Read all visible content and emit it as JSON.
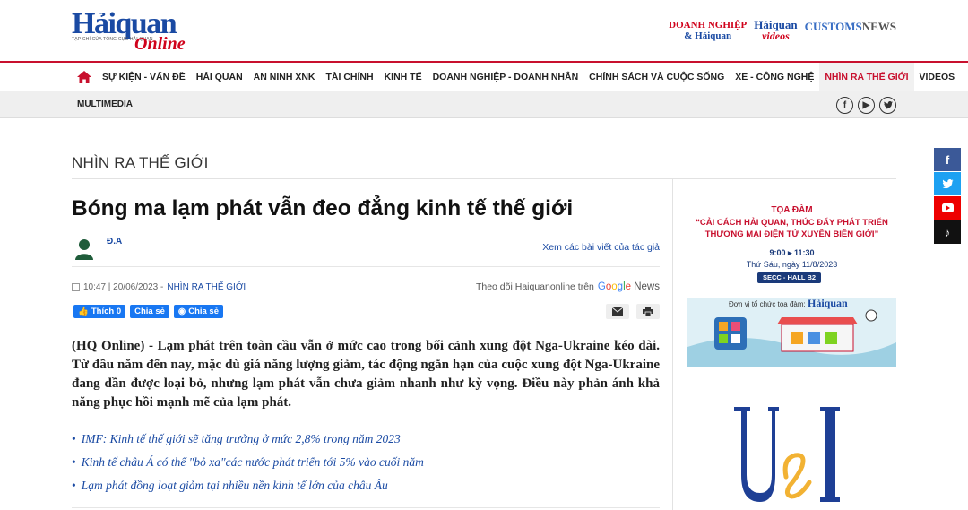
{
  "header": {
    "logo_main": "Hảiquan",
    "logo_online": "Online",
    "logo_sub": "TẠP CHÍ CỦA TỔNG CỤC HẢI QUAN",
    "partner_dn_line1": "DOANH NGHIỆP",
    "partner_dn_line2": "& Hảiquan",
    "partner_video_line1": "Hảiquan",
    "partner_video_line2": "videos",
    "partner_customs_a": "CUSTOMS",
    "partner_customs_b": "NEWS"
  },
  "nav": {
    "items": [
      "SỰ KIỆN - VẤN ĐỀ",
      "HẢI QUAN",
      "AN NINH XNK",
      "TÀI CHÍNH",
      "KINH TẾ",
      "DOANH NGHIỆP - DOANH NHÂN",
      "CHÍNH SÁCH VÀ CUỘC SỐNG",
      "XE - CÔNG NGHỆ",
      "NHÌN RA THẾ GIỚI",
      "VIDEOS"
    ],
    "active_index": 8,
    "sub_item": "MULTIMEDIA"
  },
  "article": {
    "section": "NHÌN RA THẾ GIỚI",
    "title": "Bóng ma lạm phát vẫn đeo đẳng kinh tế thế giới",
    "author": "Đ.A",
    "author_more": "Xem các bài viết của tác giả",
    "time": "10:47 | 20/06/2023 -",
    "category": "NHÌN RA THẾ GIỚI",
    "follow_text": "Theo dõi Haiquanonline trên",
    "gnews_news": "News",
    "like_label": "Thích 0",
    "share_label": "Chia sẻ",
    "messenger_share_label": "Chia sẻ",
    "lead": "(HQ Online) - Lạm phát trên toàn cầu vẫn ở mức cao trong bối cảnh xung đột Nga-Ukraine kéo dài. Từ đầu năm đến nay, mặc dù giá năng lượng giảm, tác động ngắn hạn của cuộc xung đột Nga-Ukraine đang dần được loại bỏ, nhưng lạm phát vẫn chưa giảm nhanh như kỳ vọng. Điều này phản ánh khả năng phục hồi mạnh mẽ của lạm phát.",
    "related": [
      "IMF: Kinh tế thế giới sẽ tăng trưởng ở mức 2,8% trong năm 2023",
      "Kinh tế châu Á có thể \"bỏ xa\"các nước phát triển tới 5% vào cuối năm",
      "Lạm phát đồng loạt giảm tại nhiều nền kinh tế lớn của châu Âu"
    ]
  },
  "banner": {
    "title1": "TỌA ĐÀM",
    "title2": "“CẢI CÁCH HẢI QUAN, THÚC ĐẨY PHÁT TRIỂN THƯƠNG MẠI ĐIỆN TỬ XUYÊN BIÊN GIỚI”",
    "time": "9:00 ▸ 11:30",
    "date": "Thứ Sáu, ngày 11/8/2023",
    "venue": "SECC - HALL B2",
    "org_label": "Đơn vị tổ chức tọa đàm:",
    "org_name": "Hảiquan"
  },
  "colors": {
    "accent_red": "#c8102e",
    "brand_blue": "#1a4aa3"
  }
}
